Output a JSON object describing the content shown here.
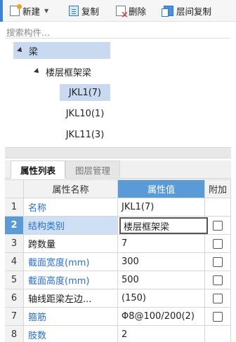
{
  "toolbar": {
    "new_label": "新建",
    "copy_label": "复制",
    "delete_label": "删除",
    "floor_copy_label": "层间复制"
  },
  "search": {
    "placeholder": "搜索构件..."
  },
  "tree": {
    "root": "梁",
    "group": "楼层框架梁",
    "items": [
      "JKL1(7)",
      "JKL10(1)",
      "JKL11(3)"
    ]
  },
  "tabs": {
    "properties": "属性列表",
    "layer_mgmt": "图层管理"
  },
  "grid": {
    "headers": {
      "num": "",
      "name": "属性名称",
      "value": "属性值",
      "extra": "附加"
    },
    "rows": [
      {
        "num": "1",
        "name": "名称",
        "value": "JKL1(7)",
        "checkbox": false
      },
      {
        "num": "2",
        "name": "结构类别",
        "value": "楼层框架梁",
        "checkbox": true
      },
      {
        "num": "3",
        "name": "跨数量",
        "value": "7",
        "checkbox": true
      },
      {
        "num": "4",
        "name": "截面宽度(mm)",
        "value": "300",
        "checkbox": true
      },
      {
        "num": "5",
        "name": "截面高度(mm)",
        "value": "500",
        "checkbox": true
      },
      {
        "num": "6",
        "name": "轴线距梁左边...",
        "value": "(150)",
        "checkbox": true
      },
      {
        "num": "7",
        "name": "箍筋",
        "value": "Φ8@100/200(2)",
        "checkbox": true
      },
      {
        "num": "8",
        "name": "肢数",
        "value": "2",
        "checkbox": false
      }
    ]
  }
}
